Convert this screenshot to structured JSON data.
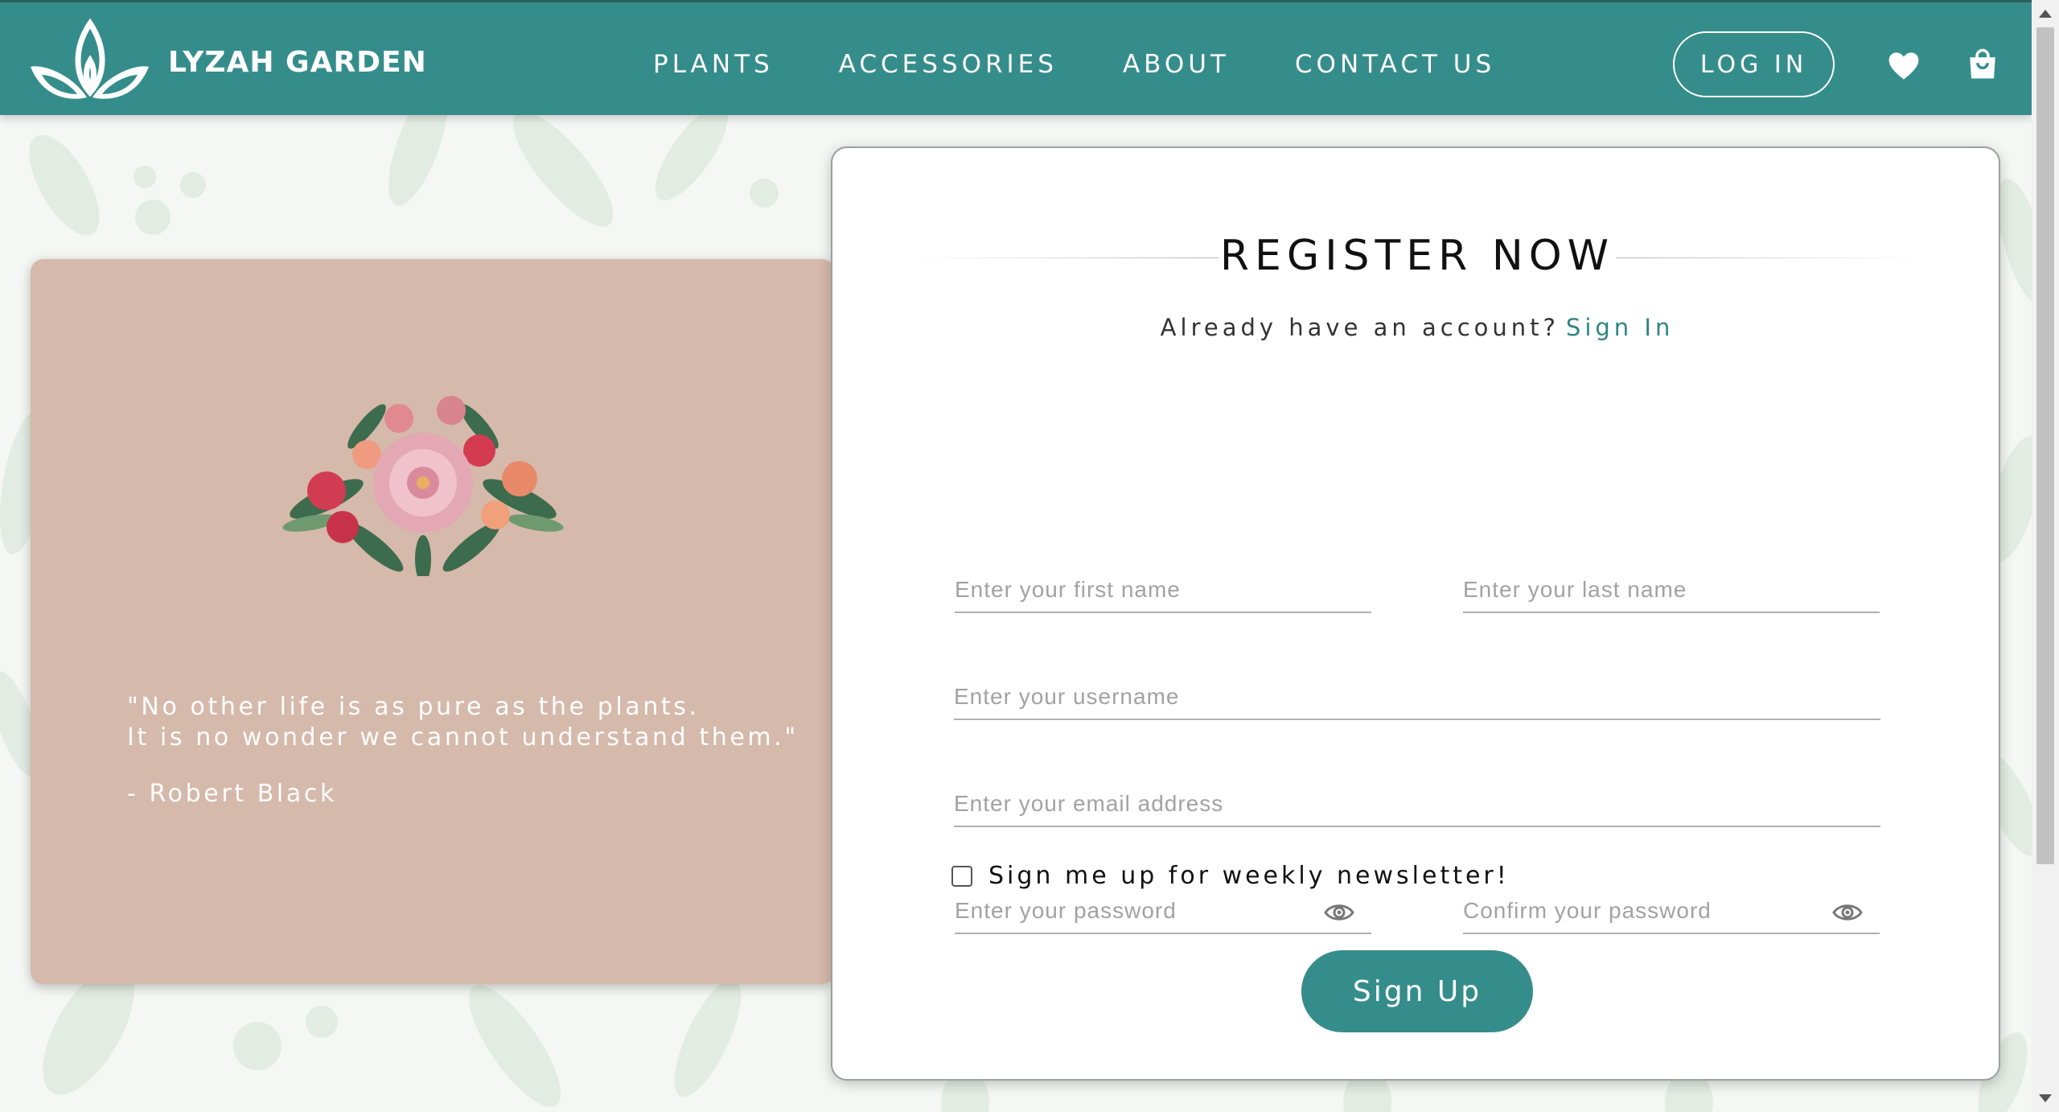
{
  "brand": {
    "name": "LYZAH GARDEN",
    "color": "#358d8b"
  },
  "nav": {
    "links": [
      "PLANTS",
      "ACCESSORIES",
      "ABOUT",
      "CONTACT US"
    ],
    "login_label": "LOG IN",
    "icons": [
      "heart-icon",
      "shopping-bag-icon"
    ]
  },
  "quote": {
    "line1": "\"No other life is as pure as the plants.",
    "line2": "It is no wonder we cannot understand them.\"",
    "author": "- Robert Black"
  },
  "register": {
    "title": "REGISTER NOW",
    "have_account": "Already have an account?",
    "signin_link": "Sign In",
    "fields": {
      "first_name": "Enter your first name",
      "last_name": "Enter your last name",
      "username": "Enter your username",
      "email": "Enter your email address",
      "password": "Enter your password",
      "confirm_password": "Confirm your password"
    },
    "newsletter_label": "Sign me up for weekly newsletter!",
    "newsletter_checked": false,
    "submit_label": "Sign Up"
  }
}
